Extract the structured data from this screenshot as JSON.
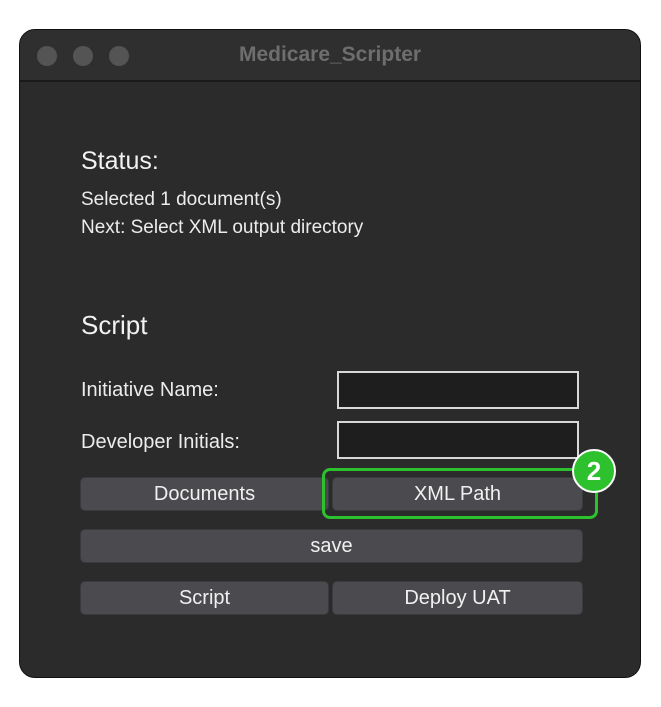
{
  "window": {
    "title": "Medicare_Scripter"
  },
  "status": {
    "heading": "Status:",
    "line1": "Selected 1 document(s)",
    "line2": "Next: Select XML output directory"
  },
  "script": {
    "heading": "Script",
    "initiative_label": "Initiative Name:",
    "initiative_value": "",
    "developer_label": "Developer Initials:",
    "developer_value": ""
  },
  "buttons": {
    "documents": "Documents",
    "xml_path": "XML Path",
    "save": "save",
    "script": "Script",
    "deploy_uat": "Deploy UAT"
  },
  "annotation": {
    "step_number": "2",
    "highlight_color": "#2ec12e"
  },
  "colors": {
    "window_bg": "#2b2b2b",
    "button_bg": "#4b4b4f",
    "input_bg": "#1e1e1e"
  }
}
